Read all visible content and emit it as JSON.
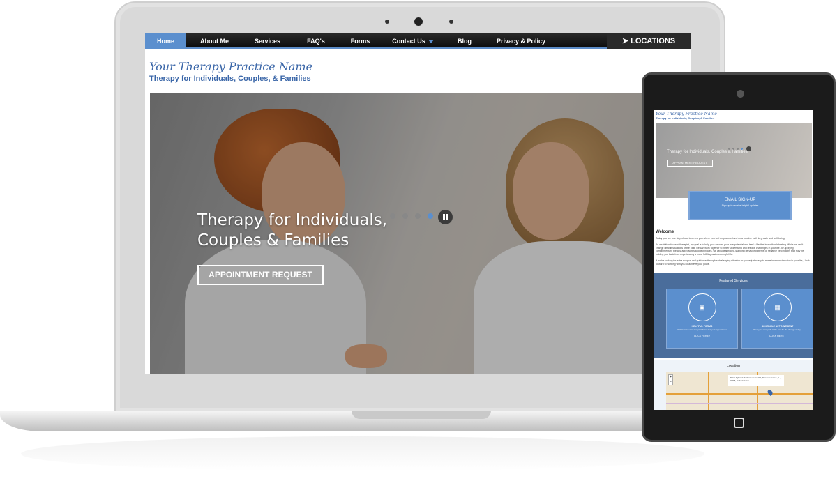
{
  "laptop": {
    "nav": {
      "items": [
        "Home",
        "About Me",
        "Services",
        "FAQ's",
        "Forms",
        "Contact Us",
        "Blog",
        "Privacy & Policy"
      ],
      "locations_label": "LOCATIONS"
    },
    "site": {
      "title": "Your Therapy Practice Name",
      "subtitle": "Therapy for Individuals, Couples, & Families"
    },
    "hero": {
      "heading": "Therapy for Individuals, Couples & Families",
      "button": "APPOINTMENT REQUEST",
      "slides": 4,
      "active_slide": 4
    }
  },
  "tablet": {
    "site": {
      "title": "Your Therapy Practice Name",
      "subtitle": "Therapy for Individuals, Couples, & Families"
    },
    "hero": {
      "heading": "Therapy for Individuals, Couples & Families",
      "button": "APPOINTMENT REQUEST"
    },
    "email": {
      "title": "EMAIL SIGN-UP",
      "subtitle": "Sign up to receive helpful updates"
    },
    "welcome": {
      "heading": "Welcome",
      "paragraphs": [
        "Today you are one step closer to a new you where you feel empowered and on a positive path to growth and well-being.",
        "As a solution-focused therapist, my goal is to help you uncover your true potential and lead a life that is worth celebrating. While we can't change difficult situations of the past, we can work together to better understand and resolve challenges in your life. By applying complementary therapy approaches and techniques, we will unearth long-standing behavior patterns or negative perceptions that may be holding you back from experiencing a more fulfilling and meaningful life.",
        "If you're looking for extra support and guidance through a challenging situation or you're just ready to move in a new direction in your life, I look forward to working with you to achieve your goals."
      ]
    },
    "featured": {
      "title": "Featured Services",
      "cards": [
        {
          "title": "HELPFUL FORMS",
          "text": "Click here to view and print forms for your appointment",
          "link": "CLICK HERE",
          "icon": "forms-icon"
        },
        {
          "title": "SCHEDULE APPOINTMENT",
          "text": "Start your new path in life and be the change today!",
          "link": "CLICK HERE",
          "icon": "calendar-icon"
        }
      ]
    },
    "location": {
      "title": "Location",
      "address": "3012 Highland Parkway Suite 200, Downers Grove, IL, 60515, United States"
    }
  }
}
